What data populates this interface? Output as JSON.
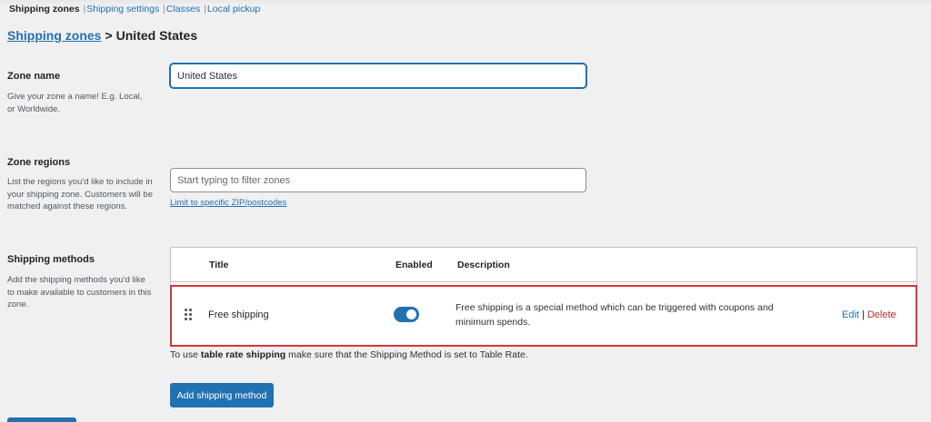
{
  "subnav": {
    "current": "Shipping zones",
    "links": [
      "Shipping settings",
      "Classes",
      "Local pickup"
    ],
    "separator": "|"
  },
  "breadcrumb": {
    "link": "Shipping zones",
    "separator": ">",
    "current": "United States"
  },
  "zone_name": {
    "label": "Zone name",
    "description": "Give your zone a name! E.g. Local, or Worldwide.",
    "value": "United States"
  },
  "zone_regions": {
    "label": "Zone regions",
    "description": "List the regions you'd like to include in your shipping zone. Customers will be matched against these regions.",
    "placeholder": "Start typing to filter zones",
    "zip_link": "Limit to specific ZIP/postcodes"
  },
  "shipping_methods": {
    "label": "Shipping methods",
    "description": "Add the shipping methods you'd like to make available to customers in this zone.",
    "columns": {
      "title": "Title",
      "enabled": "Enabled",
      "description": "Description"
    },
    "rows": [
      {
        "title": "Free shipping",
        "enabled": true,
        "description": "Free shipping is a special method which can be triggered with coupons and minimum spends.",
        "edit_label": "Edit",
        "delete_label": "Delete",
        "action_separator": "|"
      }
    ],
    "note_prefix": "To use ",
    "note_bold": "table rate shipping",
    "note_suffix": " make sure that the Shipping Method is set to Table Rate.",
    "add_button": "Add shipping method"
  },
  "colors": {
    "accent": "#2271b1",
    "delete": "#b32d2e",
    "highlight_border": "#d63638",
    "background": "#f0f0f1"
  }
}
